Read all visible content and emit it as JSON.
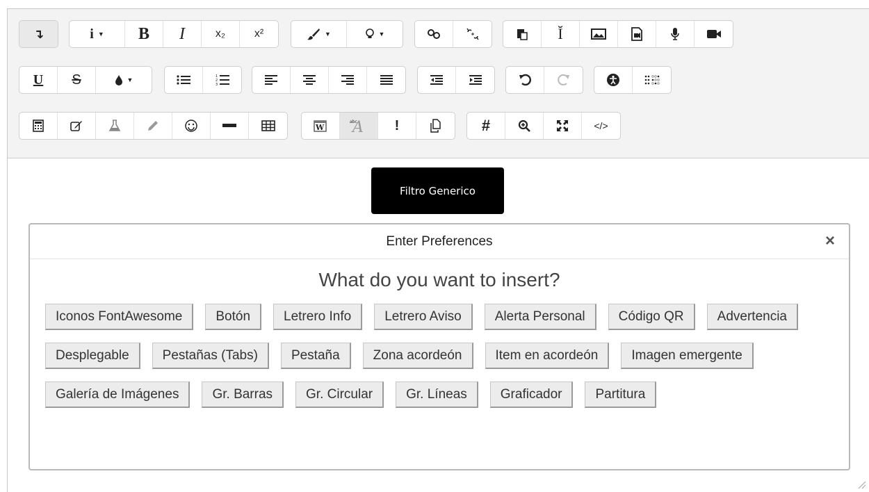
{
  "toolbar": {
    "row1": [
      {
        "name": "collapse-toolbar-button",
        "icon": "collapse-arrow-icon",
        "glyph": "↴",
        "highlight": true
      },
      {
        "name": "style-dropdown-button",
        "icon": "info-icon",
        "glyph": "i",
        "caret": true
      },
      {
        "name": "bold-button",
        "icon": "bold-icon",
        "glyph": "B"
      },
      {
        "name": "italic-button",
        "icon": "italic-icon",
        "glyph": "I"
      },
      {
        "name": "subscript-button",
        "icon": "subscript-icon",
        "glyph": "x₂"
      },
      {
        "name": "superscript-button",
        "icon": "superscript-icon",
        "glyph": "x²"
      },
      {
        "name": "text-style-dropdown-button",
        "icon": "brush-icon",
        "glyph": "🖌",
        "caret": true
      },
      {
        "name": "hint-dropdown-button",
        "icon": "lightbulb-icon",
        "glyph": "💡",
        "caret": true
      },
      {
        "name": "link-button",
        "icon": "link-icon",
        "glyph": "🔗"
      },
      {
        "name": "unlink-button",
        "icon": "unlink-icon",
        "glyph": "⛓"
      },
      {
        "name": "paste-button",
        "icon": "paste-icon",
        "glyph": "📋"
      },
      {
        "name": "cursor-button",
        "icon": "text-cursor-icon",
        "glyph": "I"
      },
      {
        "name": "insert-image-button",
        "icon": "image-icon",
        "glyph": "▨"
      },
      {
        "name": "insert-media-button",
        "icon": "media-file-icon",
        "glyph": "▣"
      },
      {
        "name": "record-audio-button",
        "icon": "microphone-icon",
        "glyph": "🎙"
      },
      {
        "name": "record-video-button",
        "icon": "video-camera-icon",
        "glyph": "■"
      }
    ],
    "row2": [
      {
        "name": "underline-button",
        "icon": "underline-icon",
        "glyph": "U"
      },
      {
        "name": "strikethrough-button",
        "icon": "strikethrough-icon",
        "glyph": "S"
      },
      {
        "name": "font-color-dropdown-button",
        "icon": "droplet-icon",
        "glyph": "💧",
        "caret": true
      },
      {
        "name": "unordered-list-button",
        "icon": "list-icon",
        "glyph": "☰"
      },
      {
        "name": "ordered-list-button",
        "icon": "numbered-list-icon",
        "glyph": "☰"
      },
      {
        "name": "align-left-button",
        "icon": "align-left-icon",
        "glyph": "≡"
      },
      {
        "name": "align-center-button",
        "icon": "align-center-icon",
        "glyph": "≡"
      },
      {
        "name": "align-right-button",
        "icon": "align-right-icon",
        "glyph": "≡"
      },
      {
        "name": "justify-button",
        "icon": "justify-icon",
        "glyph": "≡"
      },
      {
        "name": "outdent-button",
        "icon": "outdent-icon",
        "glyph": "⇤"
      },
      {
        "name": "indent-button",
        "icon": "indent-icon",
        "glyph": "⇥"
      },
      {
        "name": "undo-button",
        "icon": "undo-icon",
        "glyph": "↶"
      },
      {
        "name": "redo-button",
        "icon": "redo-icon",
        "glyph": "↷",
        "disabled": true
      },
      {
        "name": "accessibility-checker-button",
        "icon": "accessibility-icon",
        "glyph": "♿"
      },
      {
        "name": "screenreader-helper-button",
        "icon": "braille-icon",
        "glyph": "⠿"
      }
    ],
    "row3": [
      {
        "name": "equation-editor-button",
        "icon": "calculator-icon",
        "glyph": "▦"
      },
      {
        "name": "edit-button",
        "icon": "edit-icon",
        "glyph": "✎"
      },
      {
        "name": "chemistry-button",
        "icon": "flask-icon",
        "glyph": "⚗",
        "disabled": true
      },
      {
        "name": "draw-button",
        "icon": "pencil-icon",
        "glyph": "✏",
        "disabled": true
      },
      {
        "name": "emoticon-button",
        "icon": "smiley-icon",
        "glyph": "☺"
      },
      {
        "name": "horizontal-rule-button",
        "icon": "minus-icon",
        "glyph": "━"
      },
      {
        "name": "table-button",
        "icon": "table-icon",
        "glyph": "▦"
      },
      {
        "name": "paste-from-word-button",
        "icon": "word-icon",
        "glyph": "W"
      },
      {
        "name": "spellcheck-button",
        "icon": "spellcheck-icon",
        "glyph": "A",
        "active": true
      },
      {
        "name": "generic-filter-button",
        "icon": "exclamation-icon",
        "glyph": "!"
      },
      {
        "name": "copy-paste-button",
        "icon": "copy-icon",
        "glyph": "⎘"
      },
      {
        "name": "hashtag-button",
        "icon": "hashtag-icon",
        "glyph": "#"
      },
      {
        "name": "zoom-button",
        "icon": "zoom-in-icon",
        "glyph": "⊕"
      },
      {
        "name": "fullscreen-button",
        "icon": "expand-icon",
        "glyph": "✕"
      },
      {
        "name": "html-source-button",
        "icon": "code-icon",
        "glyph": "</>"
      }
    ]
  },
  "tooltip": {
    "text": "Filtro Generico"
  },
  "dialog": {
    "title": "Enter Preferences",
    "close": "×",
    "question": "What do you want to insert?",
    "options": [
      "Iconos FontAwesome",
      "Botón",
      "Letrero Info",
      "Letrero Aviso",
      "Alerta Personal",
      "Código QR",
      "Advertencia",
      "Desplegable",
      "Pestañas (Tabs)",
      "Pestaña",
      "Zona acordeón",
      "Item en acordeón",
      "Imagen emergente",
      "Galería de Imágenes",
      "Gr. Barras",
      "Gr. Circular",
      "Gr. Líneas",
      "Graficador",
      "Partitura"
    ]
  }
}
